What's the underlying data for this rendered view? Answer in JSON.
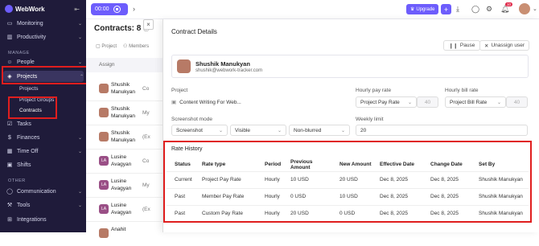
{
  "app": {
    "name": "WebWork"
  },
  "sidebar": {
    "items_top": [
      {
        "label": "Monitoring",
        "icon": "monitor-icon"
      },
      {
        "label": "Productivity",
        "icon": "chart-icon"
      }
    ],
    "section_manage": "MANAGE",
    "people": "People",
    "projects": "Projects",
    "sub_projects": "Projects",
    "sub_project_groups": "Project Groups",
    "sub_contracts": "Contracts",
    "items_mid": [
      {
        "label": "Tasks"
      },
      {
        "label": "Finances"
      },
      {
        "label": "Time Off"
      },
      {
        "label": "Shifts"
      }
    ],
    "section_other": "OTHER",
    "items_bottom": [
      {
        "label": "Communication"
      },
      {
        "label": "Tools"
      },
      {
        "label": "Integrations"
      }
    ]
  },
  "topbar": {
    "timer": "00:00",
    "upgrade": "Upgrade",
    "notification_count": "10"
  },
  "list": {
    "title": "Contracts: 8",
    "filter_project": "Project",
    "filter_members": "Members",
    "header": "Assign",
    "rows": [
      {
        "name": "Shushik Manukyan",
        "prefix": "Co",
        "initials": ""
      },
      {
        "name": "Shushik Manukyan",
        "prefix": "My",
        "initials": ""
      },
      {
        "name": "Shushik Manukyan",
        "prefix": "(Ex",
        "initials": ""
      },
      {
        "name": "Lusine Avagyan",
        "prefix": "Co",
        "initials": "LA"
      },
      {
        "name": "Lusine Avagyan",
        "prefix": "My",
        "initials": "LA"
      },
      {
        "name": "Lusine Avagyan",
        "prefix": "(Ex",
        "initials": "LA"
      },
      {
        "name": "Anahit",
        "prefix": "",
        "initials": ""
      }
    ]
  },
  "drawer": {
    "title": "Contract Details",
    "pause": "Pause",
    "unassign": "Unassign user",
    "user_name": "Shushik Manukyan",
    "user_email": "shushik@webwork-tracker.com",
    "label_project": "Project",
    "project_value": "Content Writing For Web...",
    "label_hourly_pay": "Hourly pay rate",
    "hourly_pay_select": "Project Pay Rate",
    "hourly_pay_value": "40",
    "label_hourly_bill": "Hourly bill rate",
    "hourly_bill_select": "Project Bill Rate",
    "hourly_bill_value": "40",
    "label_screenshot": "Screenshot mode",
    "screenshot_value": "Screenshot",
    "visibility_value": "Visible",
    "blur_value": "Non-blurred",
    "label_weekly": "Weekly limit",
    "weekly_value": "20"
  },
  "rate_history": {
    "title": "Rate History",
    "columns": [
      "Status",
      "Rate type",
      "Period",
      "Previous Amount",
      "New Amount",
      "Effective Date",
      "Change Date",
      "Set By"
    ],
    "rows": [
      [
        "Current",
        "Project Pay Rate",
        "Hourly",
        "10 USD",
        "20 USD",
        "Dec 8, 2025",
        "Dec 8, 2025",
        "Shushik Manukyan"
      ],
      [
        "Past",
        "Member Pay Rate",
        "Hourly",
        "0 USD",
        "10 USD",
        "Dec 8, 2025",
        "Dec 8, 2025",
        "Shushik Manukyan"
      ],
      [
        "Past",
        "Custom Pay Rate",
        "Hourly",
        "20 USD",
        "0 USD",
        "Dec 8, 2025",
        "Dec 8, 2025",
        "Shushik Manukyan"
      ]
    ]
  },
  "colors": {
    "accent": "#6d5dfc",
    "sidebar_bg": "#1f1b3a",
    "highlight": "#e01e1e"
  }
}
